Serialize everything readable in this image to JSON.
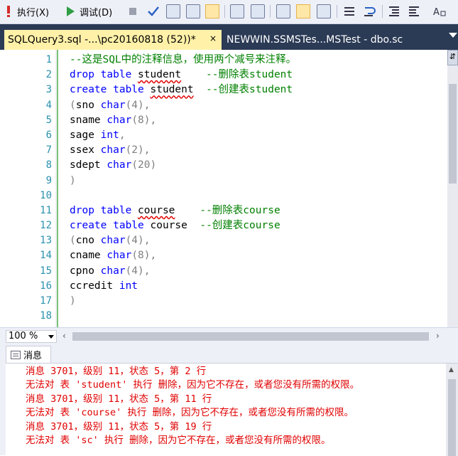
{
  "toolbar": {
    "execute_label": "执行(X)",
    "debug_label": "调试(D)"
  },
  "tabs": {
    "active": "SQLQuery3.sql -...\\pc20160818 (52))*",
    "close": "×",
    "second": "NEWWIN.SSMSTes...MSTest - dbo.sc"
  },
  "editor": {
    "line_numbers": [
      "1",
      "2",
      "3",
      "4",
      "5",
      "6",
      "7",
      "8",
      "9",
      "10",
      "11",
      "12",
      "13",
      "14",
      "15",
      "16",
      "17",
      "18"
    ],
    "lines": [
      [
        {
          "t": "--这是SQL中的注释信息，使用两个减号来注释。",
          "c": "g"
        }
      ],
      [
        {
          "t": "drop table ",
          "c": "k"
        },
        {
          "t": "student",
          "c": "sq"
        },
        {
          "t": "    --删除表student",
          "c": "g"
        }
      ],
      [
        {
          "t": "create table ",
          "c": "k"
        },
        {
          "t": "student",
          "c": "sq"
        },
        {
          "t": "  --创建表student",
          "c": "g"
        }
      ],
      [
        {
          "t": "(",
          "c": "gr"
        },
        {
          "t": "sno ",
          "c": ""
        },
        {
          "t": "char",
          "c": "k"
        },
        {
          "t": "(4),",
          "c": "gr"
        }
      ],
      [
        {
          "t": "sname ",
          "c": ""
        },
        {
          "t": "char",
          "c": "k"
        },
        {
          "t": "(8),",
          "c": "gr"
        }
      ],
      [
        {
          "t": "sage ",
          "c": ""
        },
        {
          "t": "int",
          "c": "k"
        },
        {
          "t": ",",
          "c": "gr"
        }
      ],
      [
        {
          "t": "ssex ",
          "c": ""
        },
        {
          "t": "char",
          "c": "k"
        },
        {
          "t": "(2),",
          "c": "gr"
        }
      ],
      [
        {
          "t": "sdept ",
          "c": ""
        },
        {
          "t": "char",
          "c": "k"
        },
        {
          "t": "(20)",
          "c": "gr"
        }
      ],
      [
        {
          "t": ")",
          "c": "gr"
        }
      ],
      [],
      [
        {
          "t": "drop table ",
          "c": "k"
        },
        {
          "t": "course",
          "c": "sq"
        },
        {
          "t": "    --删除表course",
          "c": "g"
        }
      ],
      [
        {
          "t": "create table ",
          "c": "k"
        },
        {
          "t": "course",
          "c": ""
        },
        {
          "t": "  --创建表course",
          "c": "g"
        }
      ],
      [
        {
          "t": "(",
          "c": "gr"
        },
        {
          "t": "cno ",
          "c": ""
        },
        {
          "t": "char",
          "c": "k"
        },
        {
          "t": "(4),",
          "c": "gr"
        }
      ],
      [
        {
          "t": "cname ",
          "c": ""
        },
        {
          "t": "char",
          "c": "k"
        },
        {
          "t": "(8),",
          "c": "gr"
        }
      ],
      [
        {
          "t": "cpno ",
          "c": ""
        },
        {
          "t": "char",
          "c": "k"
        },
        {
          "t": "(4),",
          "c": "gr"
        }
      ],
      [
        {
          "t": "ccredit ",
          "c": ""
        },
        {
          "t": "int",
          "c": "k"
        }
      ],
      [
        {
          "t": ")",
          "c": "gr"
        }
      ],
      []
    ]
  },
  "status": {
    "zoom": "100 %"
  },
  "results": {
    "tab_label": "消息",
    "messages": [
      "消息 3701，级别 11，状态 5，第 2 行",
      "无法对 表 'student' 执行 删除，因为它不存在，或者您没有所需的权限。",
      "消息 3701，级别 11，状态 5，第 11 行",
      "无法对 表 'course' 执行 删除，因为它不存在，或者您没有所需的权限。",
      "消息 3701，级别 11，状态 5，第 19 行",
      "无法对 表 'sc' 执行 删除，因为它不存在，或者您没有所需的权限。"
    ]
  },
  "colors": {
    "keyword": "#0000ff",
    "comment": "#008000",
    "error": "#e00000",
    "tab_active": "#fff1a8",
    "tab_strip": "#2b3a55"
  },
  "icons": [
    "exclamation-icon",
    "play-icon",
    "stop-icon",
    "check-icon",
    "parse-icon",
    "display-plan-icon",
    "query-options-icon",
    "intellisense-icon",
    "results-text-icon",
    "results-grid-icon",
    "results-file-icon",
    "comment-icon",
    "uncomment-icon",
    "indent-icon",
    "outdent-icon",
    "font-icon"
  ]
}
